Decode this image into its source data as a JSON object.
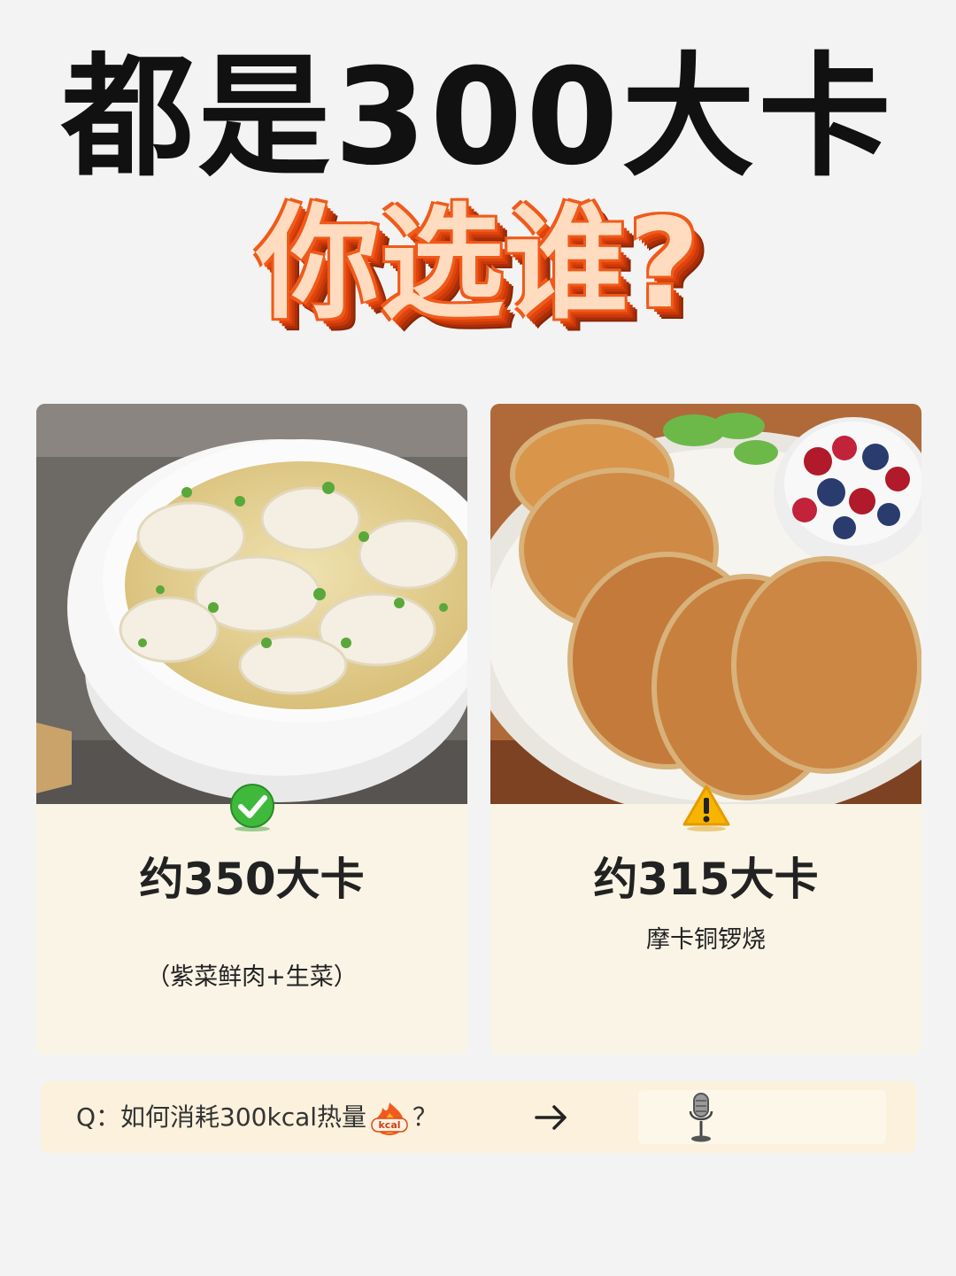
{
  "header": {
    "title": "都是300大卡",
    "subtitle": "你选谁?"
  },
  "options": [
    {
      "calorie_label": "约350大卡",
      "description": "（紫菜鲜肉+生菜）",
      "photo": "dumpling-soup-image",
      "badge_icon": "green-check-icon"
    },
    {
      "calorie_label": "约315大卡",
      "description": "摩卡铜锣烧",
      "photo": "pancakes-with-berries-image",
      "badge_icon": "warning-icon"
    }
  ],
  "question_bar": {
    "text_before": "Q：如何消耗300kcal热量",
    "kcal_icon_text": "kcal",
    "text_after": "？",
    "arrow_icon": "arrow-right-icon",
    "mic_icon": "microphone-icon"
  }
}
